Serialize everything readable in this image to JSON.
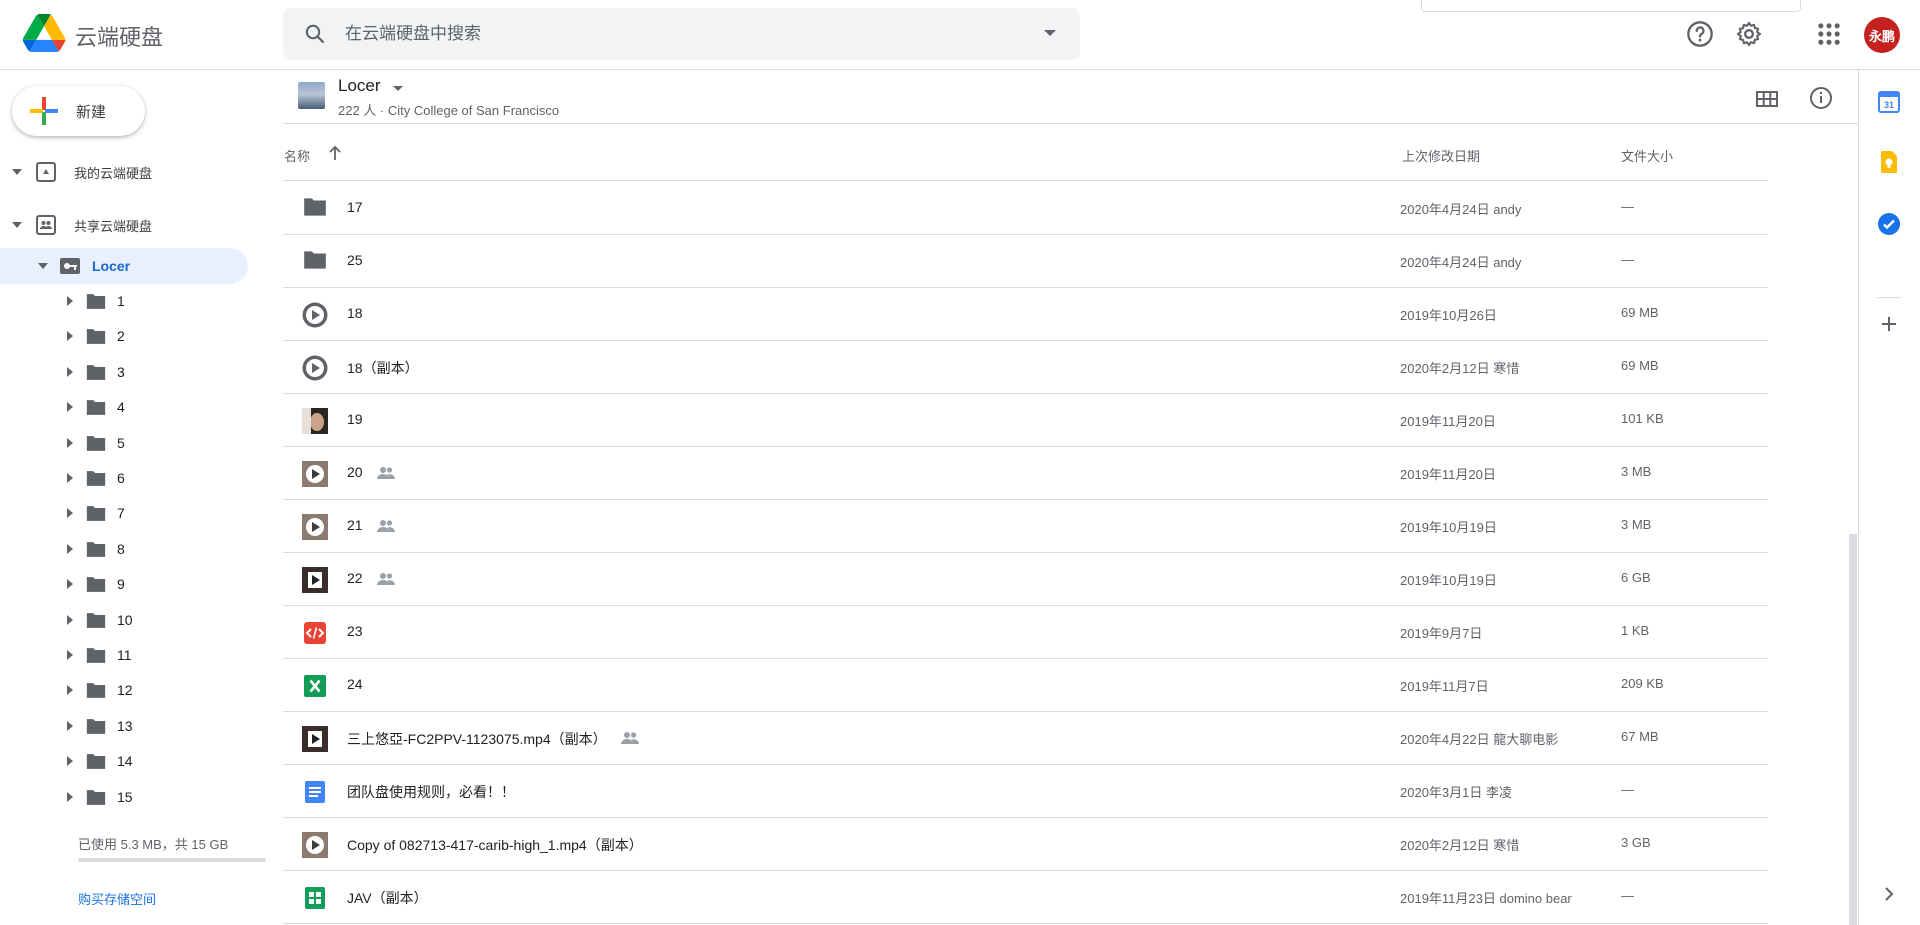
{
  "header": {
    "app_name": "云端硬盘",
    "search_placeholder": "在云端硬盘中搜索",
    "avatar_text": "永鹏",
    "icons": [
      "drive-logo-icon",
      "search-icon",
      "search-options-icon",
      "help-icon",
      "settings-icon",
      "apps-grid-icon"
    ]
  },
  "sidebar": {
    "new_label": "新建",
    "my_drive": "我的云端硬盘",
    "shared_drives": "共享云端硬盘",
    "current_drive": "Locer",
    "tree": [
      "1",
      "2",
      "3",
      "4",
      "5",
      "6",
      "7",
      "8",
      "9",
      "10",
      "11",
      "12",
      "13",
      "14",
      "15"
    ],
    "storage_text": "已使用 5.3 MB，共 15 GB",
    "buy_storage": "购买存储空间",
    "storage_used_fraction": 0.0004
  },
  "drive_header": {
    "name": "Locer",
    "subtitle": "222 人 · City College of San Francisco"
  },
  "columns": {
    "name": "名称",
    "modified": "上次修改日期",
    "size": "文件大小"
  },
  "files": [
    {
      "type": "folder",
      "name": "17",
      "date": "2020年4月24日 andy",
      "size": "—",
      "shared": false
    },
    {
      "type": "folder",
      "name": "25",
      "date": "2020年4月24日 andy",
      "size": "—",
      "shared": false
    },
    {
      "type": "video-generic",
      "name": "18",
      "date": "2019年10月26日",
      "size": "69 MB",
      "shared": false
    },
    {
      "type": "video-generic",
      "name": "18（副本）",
      "date": "2020年2月12日 寒惜",
      "size": "69 MB",
      "shared": false
    },
    {
      "type": "image-thumb",
      "name": "19",
      "date": "2019年11月20日",
      "size": "101 KB",
      "shared": false
    },
    {
      "type": "video-thumb",
      "name": "20",
      "date": "2019年11月20日",
      "size": "3 MB",
      "shared": true
    },
    {
      "type": "video-thumb",
      "name": "21",
      "date": "2019年10月19日",
      "size": "3 MB",
      "shared": true
    },
    {
      "type": "video-dark",
      "name": "22",
      "date": "2019年10月19日",
      "size": "6 GB",
      "shared": true
    },
    {
      "type": "code",
      "name": "23",
      "date": "2019年9月7日",
      "size": "1 KB",
      "shared": false
    },
    {
      "type": "sheet-excel",
      "name": "24",
      "date": "2019年11月7日",
      "size": "209 KB",
      "shared": false
    },
    {
      "type": "video-dark",
      "name": "三上悠亞-FC2PPV-1123075.mp4（副本）",
      "date": "2020年4月22日 龍大聊电影",
      "size": "67 MB",
      "shared": true
    },
    {
      "type": "doc",
      "name": "团队盘使用规则，必看！！",
      "date": "2020年3月1日 李凌",
      "size": "—",
      "shared": false
    },
    {
      "type": "video-thumb",
      "name": "Copy of 082713-417-carib-high_1.mp4（副本）",
      "date": "2020年2月12日 寒惜",
      "size": "3 GB",
      "shared": false
    },
    {
      "type": "sheet-google",
      "name": "JAV（副本）",
      "date": "2019年11月23日 domino bear",
      "size": "—",
      "shared": false
    }
  ],
  "right_rail": [
    "calendar-icon",
    "keep-icon",
    "tasks-icon",
    "add-addon-icon",
    "expand-panel-icon"
  ],
  "colors": {
    "accent": "#1a73e8",
    "selected_bg": "#e8f0fe",
    "folder": "#5f6368",
    "avatar": "#c5221f"
  }
}
